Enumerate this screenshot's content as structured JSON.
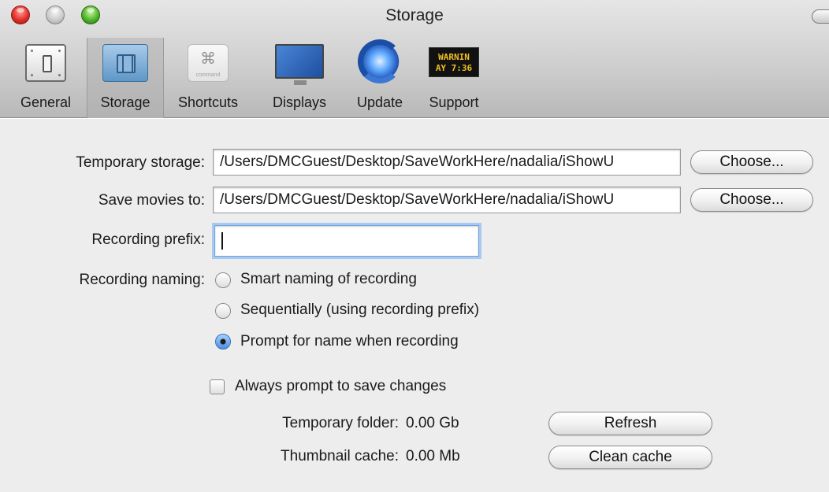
{
  "window": {
    "title": "Storage"
  },
  "toolbar": {
    "items": [
      {
        "label": "General",
        "icon": "general-switch-icon",
        "active": false
      },
      {
        "label": "Storage",
        "icon": "storage-film-icon",
        "active": true
      },
      {
        "label": "Shortcuts",
        "icon": "command-key-icon",
        "active": false
      },
      {
        "label": "Displays",
        "icon": "display-monitor-icon",
        "active": false
      },
      {
        "label": "Update",
        "icon": "update-globe-icon",
        "active": false
      },
      {
        "label": "Support",
        "icon": "warning-sign-icon",
        "active": false
      }
    ],
    "shortcuts_icon_glyph": "⌘",
    "shortcuts_icon_sub": "command",
    "support_icon_lines": [
      "WARNIN",
      "AY 7:36"
    ]
  },
  "storage": {
    "temporary_storage_label": "Temporary storage:",
    "temporary_storage_path": "/Users/DMCGuest/Desktop/SaveWorkHere/nadalia/iShowU",
    "save_movies_label": "Save movies to:",
    "save_movies_path": "/Users/DMCGuest/Desktop/SaveWorkHere/nadalia/iShowU",
    "choose_label": "Choose...",
    "recording_prefix_label": "Recording prefix:",
    "recording_prefix_value": "",
    "recording_naming_label": "Recording naming:",
    "naming_options": [
      {
        "label": "Smart naming of recording",
        "selected": false
      },
      {
        "label": "Sequentially (using recording prefix)",
        "selected": false
      },
      {
        "label": "Prompt for name when recording",
        "selected": true
      }
    ],
    "always_prompt_label": "Always prompt to save changes",
    "always_prompt_checked": false,
    "temporary_folder_label": "Temporary folder:",
    "temporary_folder_value": "0.00 Gb",
    "refresh_label": "Refresh",
    "thumbnail_cache_label": "Thumbnail cache:",
    "thumbnail_cache_value": "0.00 Mb",
    "clean_cache_label": "Clean cache"
  },
  "colors": {
    "accent": "#4a8fe0",
    "focus_ring": "#a9c9f0",
    "panel_bg": "#ededed"
  }
}
